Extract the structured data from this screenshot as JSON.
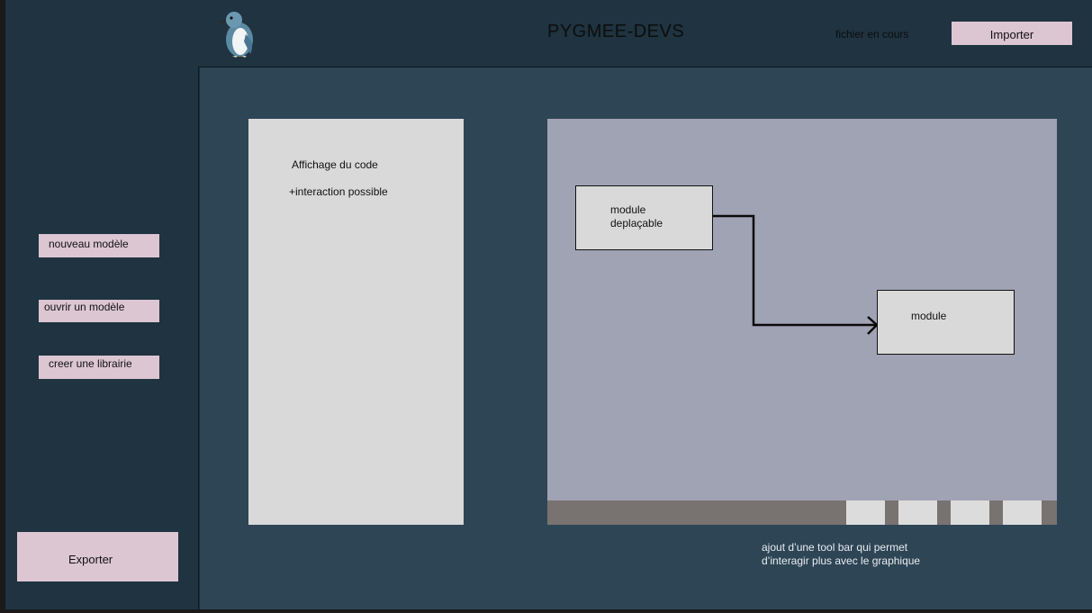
{
  "header": {
    "title": "PYGMEE-DEVS",
    "current_file": "fichier en cours",
    "import_label": "Importer"
  },
  "sidebar": {
    "items": [
      {
        "label": "nouveau modèle"
      },
      {
        "label": "ouvrir un modèle"
      },
      {
        "label": "creer une librairie"
      }
    ],
    "export_label": "Exporter"
  },
  "code_panel": {
    "line1": "Affichage du code",
    "line2": "+interaction possible"
  },
  "graph": {
    "module_a": {
      "line1": "module",
      "line2": "deplaçable"
    },
    "module_b": {
      "label": "module"
    },
    "toolbar_buttons": 4,
    "note_line1": "ajout d’une tool bar qui permet",
    "note_line2": "d’interagir plus avec le graphique"
  },
  "colors": {
    "sidebar_bg": "#1f3340",
    "main_bg": "#2e4556",
    "button_bg": "#dcc6d2",
    "graph_bg": "#a0a3b4",
    "panel_bg": "#d9d9d9",
    "toolbar_bg": "#787370"
  },
  "icons": {
    "logo": "penguin-logo-icon"
  }
}
